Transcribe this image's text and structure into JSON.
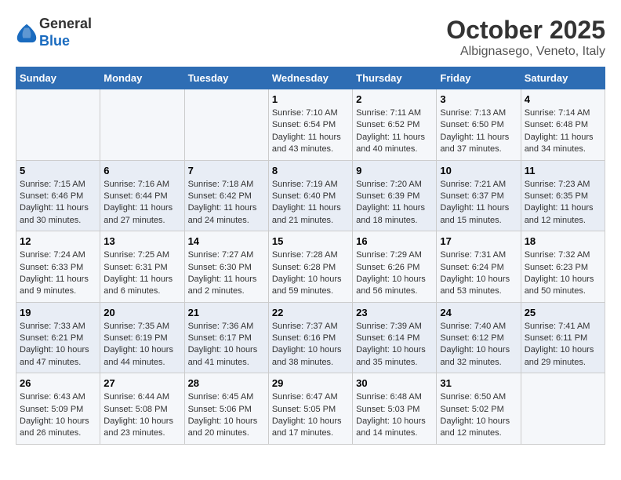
{
  "header": {
    "logo_line1": "General",
    "logo_line2": "Blue",
    "month": "October 2025",
    "location": "Albignasego, Veneto, Italy"
  },
  "weekdays": [
    "Sunday",
    "Monday",
    "Tuesday",
    "Wednesday",
    "Thursday",
    "Friday",
    "Saturday"
  ],
  "weeks": [
    [
      {
        "day": "",
        "info": ""
      },
      {
        "day": "",
        "info": ""
      },
      {
        "day": "",
        "info": ""
      },
      {
        "day": "1",
        "info": "Sunrise: 7:10 AM\nSunset: 6:54 PM\nDaylight: 11 hours and 43 minutes."
      },
      {
        "day": "2",
        "info": "Sunrise: 7:11 AM\nSunset: 6:52 PM\nDaylight: 11 hours and 40 minutes."
      },
      {
        "day": "3",
        "info": "Sunrise: 7:13 AM\nSunset: 6:50 PM\nDaylight: 11 hours and 37 minutes."
      },
      {
        "day": "4",
        "info": "Sunrise: 7:14 AM\nSunset: 6:48 PM\nDaylight: 11 hours and 34 minutes."
      }
    ],
    [
      {
        "day": "5",
        "info": "Sunrise: 7:15 AM\nSunset: 6:46 PM\nDaylight: 11 hours and 30 minutes."
      },
      {
        "day": "6",
        "info": "Sunrise: 7:16 AM\nSunset: 6:44 PM\nDaylight: 11 hours and 27 minutes."
      },
      {
        "day": "7",
        "info": "Sunrise: 7:18 AM\nSunset: 6:42 PM\nDaylight: 11 hours and 24 minutes."
      },
      {
        "day": "8",
        "info": "Sunrise: 7:19 AM\nSunset: 6:40 PM\nDaylight: 11 hours and 21 minutes."
      },
      {
        "day": "9",
        "info": "Sunrise: 7:20 AM\nSunset: 6:39 PM\nDaylight: 11 hours and 18 minutes."
      },
      {
        "day": "10",
        "info": "Sunrise: 7:21 AM\nSunset: 6:37 PM\nDaylight: 11 hours and 15 minutes."
      },
      {
        "day": "11",
        "info": "Sunrise: 7:23 AM\nSunset: 6:35 PM\nDaylight: 11 hours and 12 minutes."
      }
    ],
    [
      {
        "day": "12",
        "info": "Sunrise: 7:24 AM\nSunset: 6:33 PM\nDaylight: 11 hours and 9 minutes."
      },
      {
        "day": "13",
        "info": "Sunrise: 7:25 AM\nSunset: 6:31 PM\nDaylight: 11 hours and 6 minutes."
      },
      {
        "day": "14",
        "info": "Sunrise: 7:27 AM\nSunset: 6:30 PM\nDaylight: 11 hours and 2 minutes."
      },
      {
        "day": "15",
        "info": "Sunrise: 7:28 AM\nSunset: 6:28 PM\nDaylight: 10 hours and 59 minutes."
      },
      {
        "day": "16",
        "info": "Sunrise: 7:29 AM\nSunset: 6:26 PM\nDaylight: 10 hours and 56 minutes."
      },
      {
        "day": "17",
        "info": "Sunrise: 7:31 AM\nSunset: 6:24 PM\nDaylight: 10 hours and 53 minutes."
      },
      {
        "day": "18",
        "info": "Sunrise: 7:32 AM\nSunset: 6:23 PM\nDaylight: 10 hours and 50 minutes."
      }
    ],
    [
      {
        "day": "19",
        "info": "Sunrise: 7:33 AM\nSunset: 6:21 PM\nDaylight: 10 hours and 47 minutes."
      },
      {
        "day": "20",
        "info": "Sunrise: 7:35 AM\nSunset: 6:19 PM\nDaylight: 10 hours and 44 minutes."
      },
      {
        "day": "21",
        "info": "Sunrise: 7:36 AM\nSunset: 6:17 PM\nDaylight: 10 hours and 41 minutes."
      },
      {
        "day": "22",
        "info": "Sunrise: 7:37 AM\nSunset: 6:16 PM\nDaylight: 10 hours and 38 minutes."
      },
      {
        "day": "23",
        "info": "Sunrise: 7:39 AM\nSunset: 6:14 PM\nDaylight: 10 hours and 35 minutes."
      },
      {
        "day": "24",
        "info": "Sunrise: 7:40 AM\nSunset: 6:12 PM\nDaylight: 10 hours and 32 minutes."
      },
      {
        "day": "25",
        "info": "Sunrise: 7:41 AM\nSunset: 6:11 PM\nDaylight: 10 hours and 29 minutes."
      }
    ],
    [
      {
        "day": "26",
        "info": "Sunrise: 6:43 AM\nSunset: 5:09 PM\nDaylight: 10 hours and 26 minutes."
      },
      {
        "day": "27",
        "info": "Sunrise: 6:44 AM\nSunset: 5:08 PM\nDaylight: 10 hours and 23 minutes."
      },
      {
        "day": "28",
        "info": "Sunrise: 6:45 AM\nSunset: 5:06 PM\nDaylight: 10 hours and 20 minutes."
      },
      {
        "day": "29",
        "info": "Sunrise: 6:47 AM\nSunset: 5:05 PM\nDaylight: 10 hours and 17 minutes."
      },
      {
        "day": "30",
        "info": "Sunrise: 6:48 AM\nSunset: 5:03 PM\nDaylight: 10 hours and 14 minutes."
      },
      {
        "day": "31",
        "info": "Sunrise: 6:50 AM\nSunset: 5:02 PM\nDaylight: 10 hours and 12 minutes."
      },
      {
        "day": "",
        "info": ""
      }
    ]
  ]
}
